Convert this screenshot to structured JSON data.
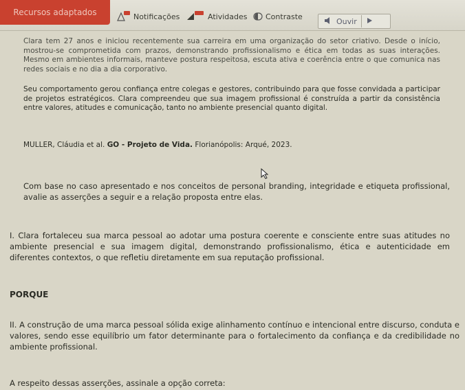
{
  "toolbar": {
    "brand_label": "Recursos adaptados",
    "notifications_label": "Notificações",
    "activities_label": "Atividades",
    "contrast_label": "Contraste",
    "listen_label": "Ouvir",
    "icons": [
      "bell-icon",
      "activities-icon",
      "contrast-icon",
      "speaker-icon",
      "play-icon"
    ]
  },
  "case": {
    "paragraph_1": "Clara tem 27 anos e iniciou recentemente sua carreira em uma organização do setor criativo. Desde o início, mostrou-se comprometida com prazos, demonstrando profissionalismo e ética em todas as suas interações. Mesmo em ambientes informais, manteve postura respeitosa, escuta ativa e coerência entre o que comunica nas redes sociais e no dia a dia corporativo.",
    "paragraph_2": "Seu comportamento gerou confiança entre colegas e gestores, contribuindo para que fosse convidada a participar de projetos estratégicos. Clara compreendeu que sua imagem profissional é construída a partir da consistência entre valores, atitudes e comunicação, tanto no ambiente presencial quanto digital.",
    "reference_prefix": "MULLER, Cláudia et al. ",
    "reference_title": "GO - Projeto de Vida.",
    "reference_suffix": " Florianópolis: Arqué, 2023."
  },
  "question": {
    "instruction": "Com base no caso apresentado e nos conceitos de personal branding, integridade e etiqueta profissional, avalie as asserções a seguir e a relação proposta entre elas.",
    "assertion_1": "I. Clara fortaleceu sua marca pessoal ao adotar uma postura coerente e consciente entre suas atitudes no ambiente presencial e sua imagem digital, demonstrando profissionalismo, ética e autenticidade em diferentes contextos, o que refletiu diretamente em sua reputação profissional.",
    "connector": "PORQUE",
    "assertion_2": "II. A construção de uma marca pessoal sólida exige alinhamento contínuo e intencional entre discurso, conduta e valores, sendo esse equilíbrio um fator determinante para o fortalecimento da confiança e da credibilidade no ambiente profissional.",
    "prompt": "A respeito dessas asserções, assinale a opção correta:"
  },
  "colors": {
    "brand": "#c9412f",
    "background": "#d9d6c7"
  }
}
